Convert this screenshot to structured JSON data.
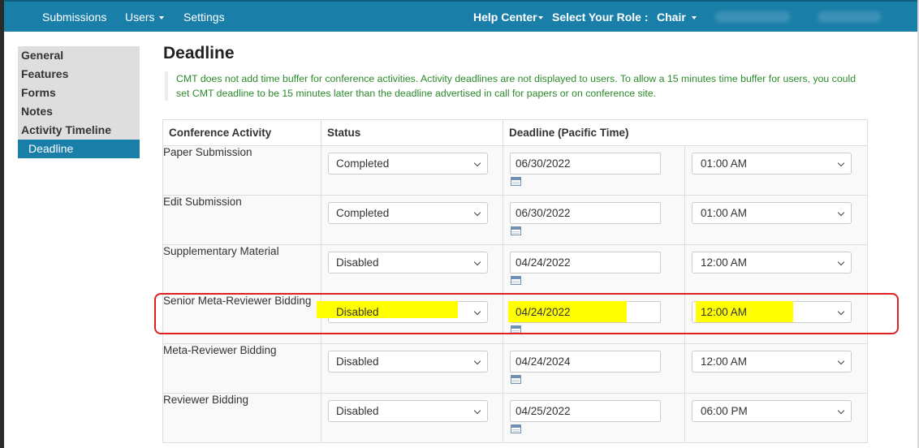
{
  "navbar": {
    "items": [
      "Submissions",
      "Users",
      "Settings"
    ],
    "help_center": "Help Center",
    "role_label": "Select Your Role :",
    "role_value": "Chair"
  },
  "sidebar": {
    "items": [
      "General",
      "Features",
      "Forms",
      "Notes",
      "Activity Timeline"
    ],
    "active_sub": "Deadline"
  },
  "page": {
    "title": "Deadline",
    "notice": "CMT does not add time buffer for conference activities. Activity deadlines are not displayed to users. To allow a 15 minutes time buffer for users, you could set CMT deadline to be 15 minutes later than the deadline advertised in call for papers or on conference site."
  },
  "table": {
    "headers": [
      "Conference Activity",
      "Status",
      "Deadline (Pacific Time)"
    ],
    "rows": [
      {
        "activity": "Paper Submission",
        "status": "Completed",
        "date": "06/30/2022",
        "time": "01:00 AM"
      },
      {
        "activity": "Edit Submission",
        "status": "Completed",
        "date": "06/30/2022",
        "time": "01:00 AM"
      },
      {
        "activity": "Supplementary Material",
        "status": "Disabled",
        "date": "04/24/2022",
        "time": "12:00 AM"
      },
      {
        "activity": "Senior Meta-Reviewer Bidding",
        "status": "Disabled",
        "date": "04/24/2022",
        "time": "12:00 AM"
      },
      {
        "activity": "Meta-Reviewer Bidding",
        "status": "Disabled",
        "date": "04/24/2024",
        "time": "12:00 AM"
      },
      {
        "activity": "Reviewer Bidding",
        "status": "Disabled",
        "date": "04/25/2022",
        "time": "06:00 PM"
      }
    ]
  },
  "colors": {
    "navbar": "#1a7fa8",
    "highlight": "#ffff00",
    "annotation": "#e02020",
    "notice_text": "#2a8a2a"
  }
}
